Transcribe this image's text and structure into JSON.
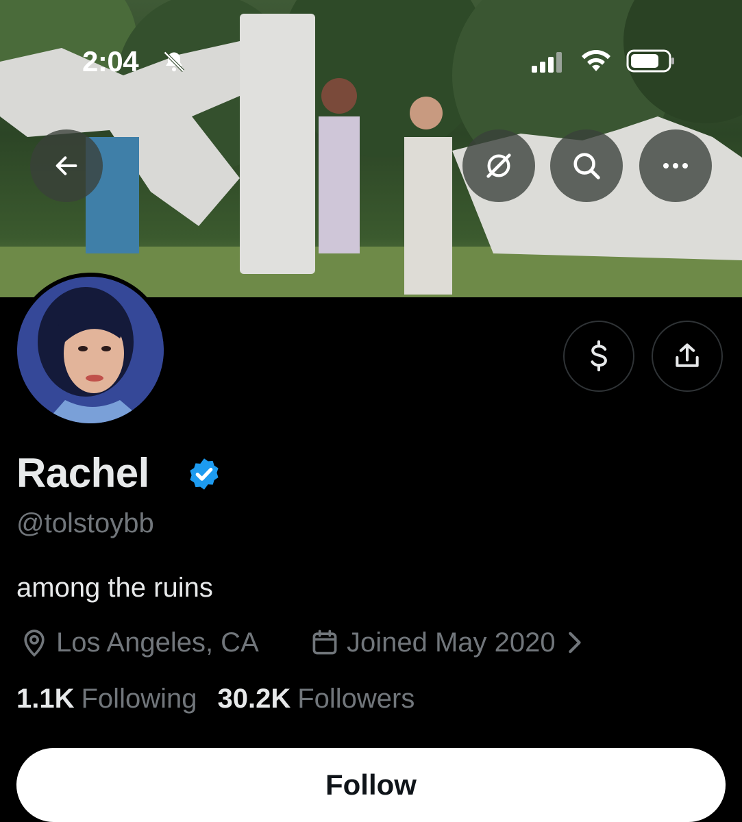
{
  "status_bar": {
    "time": "2:04",
    "icons": [
      "bell-slash-icon",
      "cellular-signal-icon",
      "wifi-icon",
      "battery-icon"
    ]
  },
  "header": {
    "buttons": [
      "back-arrow-icon",
      "grok-icon",
      "search-icon",
      "more-icon"
    ]
  },
  "profile": {
    "name": "Rachel",
    "verified": true,
    "handle": "@tolstoybb",
    "bio": "among the ruins",
    "location": "Los Angeles, CA",
    "joined": "Joined May 2020",
    "following_count": "1.1K",
    "following_label": "Following",
    "followers_count": "30.2K",
    "followers_label": "Followers"
  },
  "actions": {
    "tip_icon": "dollar-sign-icon",
    "share_icon": "share-upload-icon",
    "follow_label": "Follow"
  },
  "colors": {
    "background": "#000000",
    "primary_text": "#e7e9ea",
    "secondary_text": "#71767b",
    "verified_blue": "#1d9bf0",
    "follow_button_bg": "#ffffff"
  }
}
